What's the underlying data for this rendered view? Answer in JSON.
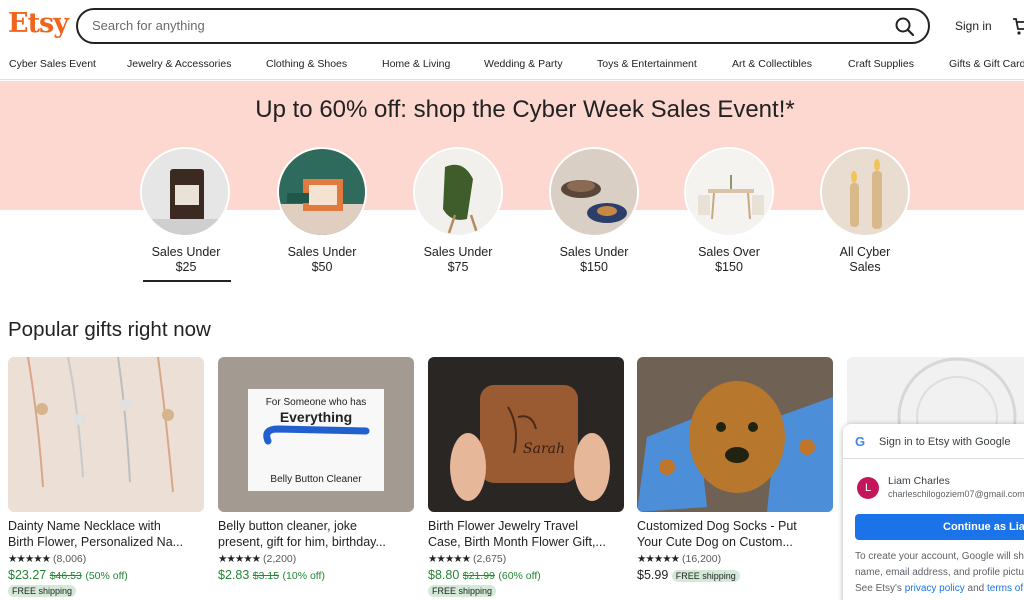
{
  "header": {
    "logo": "Etsy",
    "search_placeholder": "Search for anything",
    "sign_in": "Sign in",
    "accent_color": "#f1641e"
  },
  "categories": [
    "Cyber Sales Event",
    "Jewelry & Accessories",
    "Clothing & Shoes",
    "Home & Living",
    "Wedding & Party",
    "Toys & Entertainment",
    "Art & Collectibles",
    "Craft Supplies",
    "Gifts & Gift Cards"
  ],
  "hero": {
    "title": "Up to 60% off: shop the Cyber Week Sales Event!*",
    "background": "#fcd8d1",
    "circles": [
      {
        "line1": "Sales Under",
        "line2": "$25",
        "selected": true
      },
      {
        "line1": "Sales Under",
        "line2": "$50"
      },
      {
        "line1": "Sales Under",
        "line2": "$75"
      },
      {
        "line1": "Sales Under",
        "line2": "$150"
      },
      {
        "line1": "Sales Over",
        "line2": "$150"
      },
      {
        "line1": "All Cyber",
        "line2": "Sales"
      }
    ]
  },
  "popular": {
    "title": "Popular gifts right now",
    "items": [
      {
        "title1": "Dainty Name Necklace with",
        "title2": "Birth Flower, Personalized Na...",
        "stars": "★★★★★",
        "reviews": "(8,006)",
        "price": "$23.27",
        "original": "$46.53",
        "discount": "(50% off)",
        "shipping": "FREE shipping"
      },
      {
        "title1": "Belly button cleaner, joke",
        "title2": "present, gift for him, birthday...",
        "stars": "★★★★★",
        "reviews": "(2,200)",
        "price": "$2.83",
        "original": "$3.15",
        "discount": "(10% off)"
      },
      {
        "title1": "Birth Flower Jewelry Travel",
        "title2": "Case, Birth Month Flower Gift,...",
        "stars": "★★★★★",
        "reviews": "(2,675)",
        "price": "$8.80",
        "original": "$21.99",
        "discount": "(60% off)",
        "shipping": "FREE shipping",
        "image_text": "Sarah"
      },
      {
        "title1": "Customized Dog Socks - Put",
        "title2": "Your Cute Dog on Custom...",
        "stars": "★★★★★",
        "reviews": "(16,200)",
        "price": "$5.99",
        "shipping": "FREE shipping"
      }
    ],
    "card2_image_text": {
      "line1": "For Someone who has",
      "line2": "Everything",
      "line3": "Belly Button Cleaner"
    }
  },
  "google_popup": {
    "title": "Sign in to Etsy with Google",
    "avatar_initial": "L",
    "name": "Liam Charles",
    "email": "charleschilogoziem07@gmail.com",
    "button": "Continue as Liam",
    "text1": "To create your account, Google will share your",
    "text2": "name, email address, and profile picture with Etsy.",
    "text3_prefix": "See Etsy's",
    "privacy": "privacy policy",
    "and": "and",
    "terms": "terms of service"
  }
}
